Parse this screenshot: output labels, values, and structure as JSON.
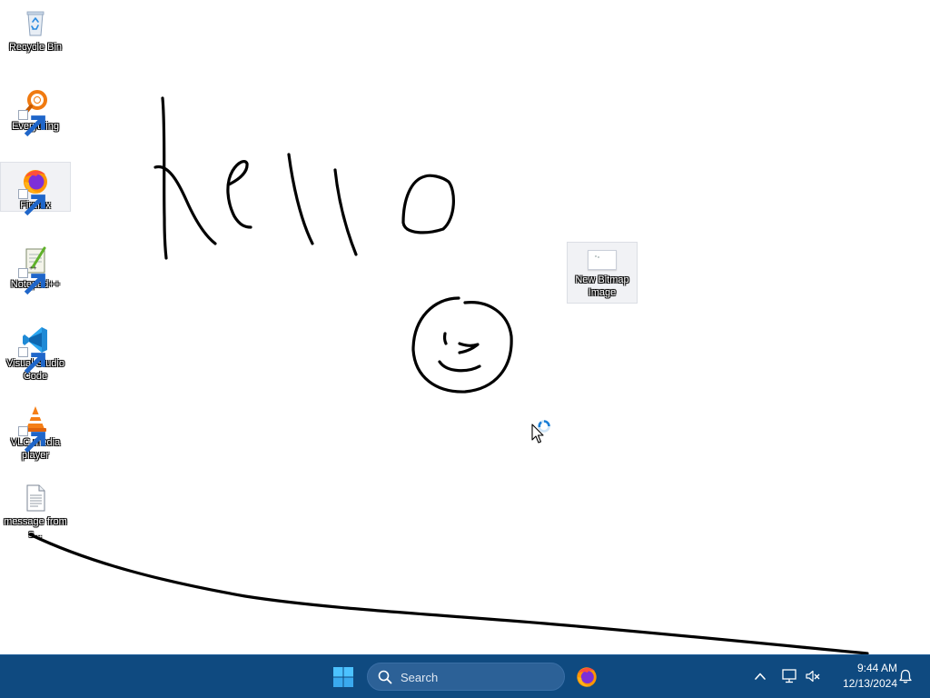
{
  "desktop": {
    "icons": [
      {
        "label": "Recycle Bin",
        "icon": "recycle-bin-icon",
        "shortcut": false
      },
      {
        "label": "Everything",
        "icon": "everything-search-icon",
        "shortcut": true
      },
      {
        "label": "Firefox",
        "icon": "firefox-icon",
        "shortcut": true,
        "selected": true
      },
      {
        "label": "Notepad++",
        "icon": "notepad-plus-plus-icon",
        "shortcut": true
      },
      {
        "label": "Visual Studio Code",
        "icon": "vscode-icon",
        "shortcut": true
      },
      {
        "label": "VLC media player",
        "icon": "vlc-icon",
        "shortcut": true
      },
      {
        "label": "message from s...",
        "icon": "text-document-icon",
        "shortcut": false
      }
    ],
    "bitmap_file": {
      "label": "New Bitmap Image",
      "icon": "bitmap-image-icon"
    },
    "drawing": {
      "description_word": "hello",
      "stroke_color": "#000000"
    },
    "cursor": "busy-cursor-icon"
  },
  "taskbar": {
    "background": "#0f4a80",
    "start_icon": "windows-start-icon",
    "search_placeholder": "Search",
    "pinned": [
      {
        "name": "Firefox",
        "icon": "firefox-icon"
      }
    ],
    "tray": {
      "chevron_icon": "chevron-up-icon",
      "network_icon": "network-icon",
      "volume_icon": "volume-muted-icon",
      "notification_icon": "bell-icon"
    },
    "clock": {
      "time": "9:44 AM",
      "date": "12/13/2024"
    }
  }
}
